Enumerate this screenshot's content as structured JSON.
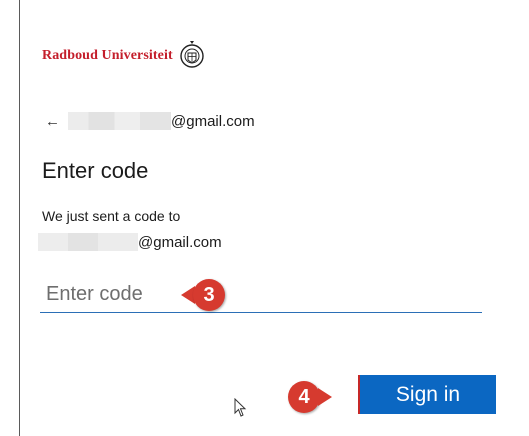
{
  "brand": {
    "name": "Radboud Universiteit",
    "logo_icon": "university-seal-icon"
  },
  "identity": {
    "back_icon": "←",
    "email_suffix": "@gmail.com"
  },
  "page": {
    "title": "Enter code",
    "sent_message": "We just sent a code to",
    "sent_email_suffix": "@gmail.com"
  },
  "code_input": {
    "placeholder": "Enter code",
    "value": ""
  },
  "sign_in": {
    "label": "Sign in",
    "color": "#0b67c2"
  },
  "callouts": {
    "first": "3",
    "second": "4",
    "color": "#d63a2f"
  },
  "colors": {
    "brand": "#c41e2b",
    "accent": "#2b6fb6"
  }
}
